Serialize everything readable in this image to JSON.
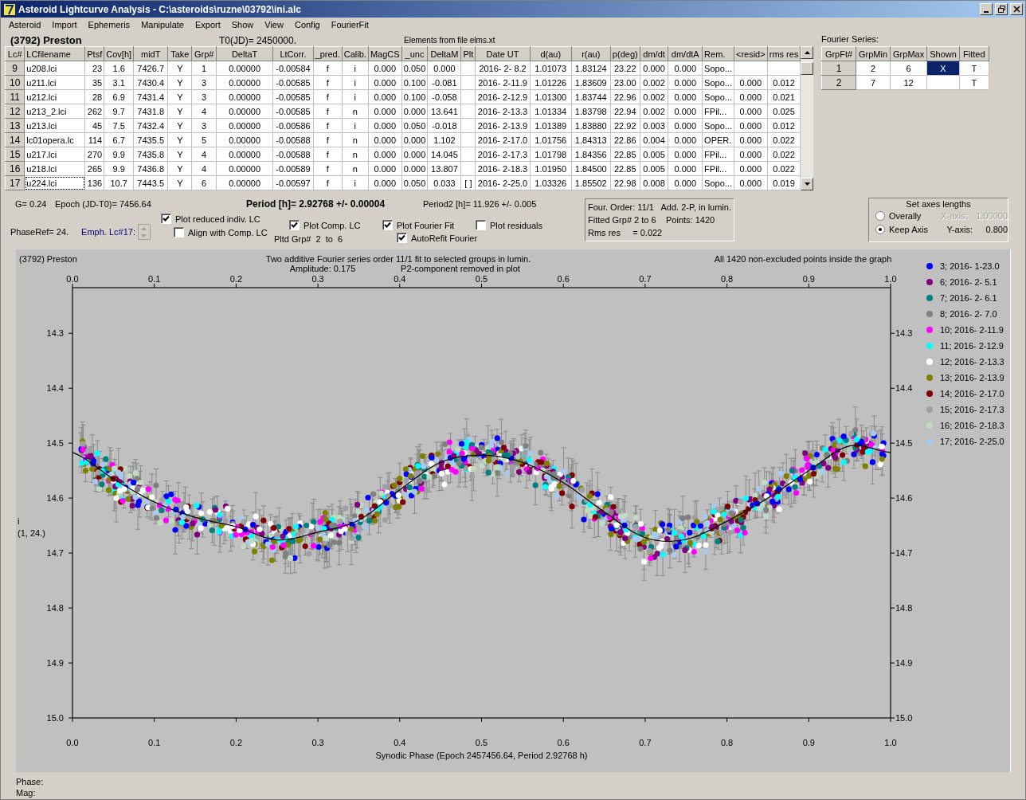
{
  "window": {
    "title": "Asteroid Lightcurve Analysis - C:\\asteroids\\ruzne\\03792\\ini.alc"
  },
  "menu": [
    "Asteroid",
    "Import",
    "Ephemeris",
    "Manipulate",
    "Export",
    "Show",
    "View",
    "Config",
    "FourierFit"
  ],
  "object_name": "(3792) Preston",
  "t0": "T0(JD)= 2450000.",
  "elements_note": "Elements from file elms.xt",
  "table": {
    "columns": [
      "Lc#",
      "LCfilename",
      "Ptsf",
      "Cov[h]",
      "midT",
      "Take",
      "Grp#",
      "DeltaT",
      "LtCorr.",
      "_pred.",
      "Calib.",
      "MagCS",
      "_unc",
      "DeltaM",
      "Plt",
      "Date UT",
      "d(au)",
      "r(au)",
      "p(deg)",
      "dm/dt",
      "dm/dtA",
      "Rem.",
      "<resid>",
      "rms res"
    ],
    "rows": [
      {
        "cells": [
          "9",
          "u208.lci",
          "23",
          "1.6",
          "7426.7",
          "Y",
          "1",
          "0.00000",
          "-0.00584",
          "f",
          "i",
          "0.000",
          "0.050",
          "0.000",
          "",
          "2016- 2- 8.2",
          "1.01073",
          "1.83124",
          "23.22",
          "0.000",
          "0.000",
          "Sopo...",
          "",
          ""
        ],
        "focused": false
      },
      {
        "cells": [
          "10",
          "u211.lci",
          "35",
          "3.1",
          "7430.4",
          "Y",
          "3",
          "0.00000",
          "-0.00585",
          "f",
          "i",
          "0.000",
          "0.100",
          "-0.081",
          "",
          "2016- 2-11.9",
          "1.01226",
          "1.83609",
          "23.00",
          "0.002",
          "0.000",
          "Sopo...",
          "0.000",
          "0.012"
        ],
        "focused": false
      },
      {
        "cells": [
          "11",
          "u212.lci",
          "28",
          "6.9",
          "7431.4",
          "Y",
          "3",
          "0.00000",
          "-0.00585",
          "f",
          "i",
          "0.000",
          "0.100",
          "-0.058",
          "",
          "2016- 2-12.9",
          "1.01300",
          "1.83744",
          "22.96",
          "0.002",
          "0.000",
          "Sopo...",
          "0.000",
          "0.021"
        ],
        "focused": false
      },
      {
        "cells": [
          "12",
          "u213_2.lci",
          "262",
          "9.7",
          "7431.8",
          "Y",
          "4",
          "0.00000",
          "-0.00585",
          "f",
          "n",
          "0.000",
          "0.000",
          "13.641",
          "",
          "2016- 2-13.3",
          "1.01334",
          "1.83798",
          "22.94",
          "0.002",
          "0.000",
          "FPil...",
          "0.000",
          "0.025"
        ],
        "focused": false
      },
      {
        "cells": [
          "13",
          "u213.lci",
          "45",
          "7.5",
          "7432.4",
          "Y",
          "3",
          "0.00000",
          "-0.00586",
          "f",
          "i",
          "0.000",
          "0.050",
          "-0.018",
          "",
          "2016- 2-13.9",
          "1.01389",
          "1.83880",
          "22.92",
          "0.003",
          "0.000",
          "Sopo...",
          "0.000",
          "0.012"
        ],
        "focused": false
      },
      {
        "cells": [
          "14",
          "lc01opera.lc",
          "114",
          "6.7",
          "7435.5",
          "Y",
          "5",
          "0.00000",
          "-0.00588",
          "f",
          "n",
          "0.000",
          "0.000",
          "1.102",
          "",
          "2016- 2-17.0",
          "1.01756",
          "1.84313",
          "22.86",
          "0.004",
          "0.000",
          "OPER.",
          "0.000",
          "0.022"
        ],
        "focused": false
      },
      {
        "cells": [
          "15",
          "u217.lci",
          "270",
          "9.9",
          "7435.8",
          "Y",
          "4",
          "0.00000",
          "-0.00588",
          "f",
          "n",
          "0.000",
          "0.000",
          "14.045",
          "",
          "2016- 2-17.3",
          "1.01798",
          "1.84356",
          "22.85",
          "0.005",
          "0.000",
          "FPil...",
          "0.000",
          "0.022"
        ],
        "focused": false
      },
      {
        "cells": [
          "16",
          "u218.lci",
          "265",
          "9.9",
          "7436.8",
          "Y",
          "4",
          "0.00000",
          "-0.00589",
          "f",
          "n",
          "0.000",
          "0.000",
          "13.807",
          "",
          "2016- 2-18.3",
          "1.01950",
          "1.84500",
          "22.85",
          "0.005",
          "0.000",
          "FPil...",
          "0.000",
          "0.022"
        ],
        "focused": false
      },
      {
        "cells": [
          "17",
          "u224.lci",
          "136",
          "10.7",
          "7443.5",
          "Y",
          "6",
          "0.00000",
          "-0.00597",
          "f",
          "i",
          "0.000",
          "0.050",
          "0.033",
          "[ ]",
          "2016- 2-25.0",
          "1.03326",
          "1.85502",
          "22.98",
          "0.008",
          "0.000",
          "Sopo...",
          "0.000",
          "0.019"
        ],
        "focused": true
      }
    ]
  },
  "fourier_series": {
    "label": "Fourier Series:",
    "columns": [
      "GrpFt#",
      "GrpMin",
      "GrpMax",
      "Shown",
      "Fitted"
    ],
    "rows": [
      {
        "cells": [
          "1",
          "2",
          "6",
          "X",
          "T"
        ],
        "selected": true
      },
      {
        "cells": [
          "2",
          "7",
          "12",
          "",
          "T"
        ],
        "selected": false
      }
    ]
  },
  "info": {
    "g": "G= 0.24",
    "epoch": "Epoch (JD-T0)= 7456.64",
    "period": "Period [h]= 2.92768 +/- 0.00004",
    "period2": "Period2 [h]= 11.926 +/- 0.005",
    "phase_ref": "PhaseRef= 24.",
    "emph": "Emph. Lc#17:"
  },
  "options": [
    {
      "label": "Plot reduced indiv. LC",
      "checked": true
    },
    {
      "label": "Align with Comp. LC",
      "checked": false
    },
    {
      "label": "Plot Comp. LC",
      "checked": true
    },
    {
      "label": "Plot Fourier Fit",
      "checked": true
    },
    {
      "label": "AutoRefit Fourier",
      "checked": true
    },
    {
      "label": "Plot residuals",
      "checked": false
    }
  ],
  "plotted_groups": "Pltd Grp#  2  to  6",
  "fit_summary": [
    [
      "Four. Order: 11/1",
      "Add. 2-P, in lumin."
    ],
    [
      "Fitted Grp# 2 to 6",
      "Points: 1420"
    ],
    [
      "Rms res     = 0.022"
    ]
  ],
  "axes_lengths": {
    "title": "Set axes lengths",
    "options": [
      {
        "label": "Overally",
        "selected": false,
        "axis_label": "X-axis:",
        "axis_value": "1.00000",
        "disabled": true
      },
      {
        "label": "Keep Axis",
        "selected": true,
        "axis_label": "Y-axis:",
        "axis_value": "0.800",
        "disabled": false
      }
    ]
  },
  "plot": {
    "object": "(3792) Preston",
    "title": "Two additive Fourier series order 11/1 fit to selected groups in lumin.",
    "amplitude": "Amplitude: 0.175",
    "note": "P2-component removed in plot",
    "points_note": "All 1420 non-excluded points inside the graph",
    "y_label": "i",
    "y_sublabel": "(1, 24.)",
    "legend": [
      {
        "label": "3; 2016- 1-23.0",
        "color": "#0000ff"
      },
      {
        "label": "6; 2016- 2- 5.1",
        "color": "#800080"
      },
      {
        "label": "7; 2016- 2- 6.1",
        "color": "#008080"
      },
      {
        "label": "8; 2016- 2- 7.0",
        "color": "#808080"
      },
      {
        "label": "10; 2016- 2-11.9",
        "color": "#ff00ff"
      },
      {
        "label": "11; 2016- 2-12.9",
        "color": "#00ffff"
      },
      {
        "label": "12; 2016- 2-13.3",
        "color": "#ffffff"
      },
      {
        "label": "13; 2016- 2-13.9",
        "color": "#808000"
      },
      {
        "label": "14; 2016- 2-17.0",
        "color": "#800000"
      },
      {
        "label": "15; 2016- 2-17.3",
        "color": "#a0a0a4"
      },
      {
        "label": "16; 2016- 2-18.3",
        "color": "#c0dcc0"
      },
      {
        "label": "17; 2016- 2-25.0",
        "color": "#a6caf0"
      }
    ],
    "chart_data": {
      "type": "line",
      "xlabel": "Synodic Phase (Epoch 2457456.64, Period 2.92768 h)",
      "x": [
        0,
        0.05,
        0.1,
        0.15,
        0.2,
        0.25,
        0.3,
        0.35,
        0.4,
        0.45,
        0.5,
        0.55,
        0.6,
        0.65,
        0.7,
        0.75,
        0.8,
        0.85,
        0.9,
        0.95,
        1.0
      ],
      "series": [
        {
          "color": "#000000",
          "values": [
            14.517,
            14.565,
            14.607,
            14.635,
            14.652,
            14.676,
            14.662,
            14.64,
            14.585,
            14.535,
            14.522,
            14.535,
            14.572,
            14.625,
            14.672,
            14.675,
            14.642,
            14.6,
            14.55,
            14.505,
            14.517
          ]
        }
      ],
      "xlim": [
        0,
        1
      ],
      "ylim": [
        15.0,
        14.217
      ],
      "xticks": [
        {
          "value": 0,
          "label": "0.0"
        },
        {
          "value": 0.1,
          "label": "0.1"
        },
        {
          "value": 0.2,
          "label": "0.2"
        },
        {
          "value": 0.3,
          "label": "0.3"
        },
        {
          "value": 0.4,
          "label": "0.4"
        },
        {
          "value": 0.5,
          "label": "0.5"
        },
        {
          "value": 0.6,
          "label": "0.6"
        },
        {
          "value": 0.7,
          "label": "0.7"
        },
        {
          "value": 0.8,
          "label": "0.8"
        },
        {
          "value": 0.9,
          "label": "0.9"
        },
        {
          "value": 1,
          "label": "1.0"
        }
      ],
      "yticks": [
        {
          "value": 14.3,
          "label": "14.3"
        },
        {
          "value": 14.4,
          "label": "14.4"
        },
        {
          "value": 14.5,
          "label": "14.5"
        },
        {
          "value": 14.6,
          "label": "14.6"
        },
        {
          "value": 14.7,
          "label": "14.7"
        },
        {
          "value": 14.8,
          "label": "14.8"
        },
        {
          "value": 14.9,
          "label": "14.9"
        },
        {
          "value": 15.0,
          "label": "15.0"
        }
      ]
    }
  },
  "status": [
    "Phase:",
    "Mag:"
  ]
}
